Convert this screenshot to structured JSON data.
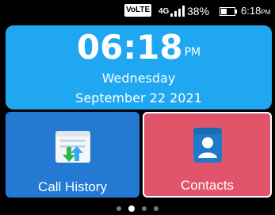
{
  "status_bar": {
    "volte": "VoLTE",
    "network": "4G",
    "battery_percent": "38%",
    "time": "6:18",
    "time_suffix": "PM",
    "signal_icon": "signal-icon",
    "battery_icon": "battery-icon"
  },
  "clock": {
    "time": "06:18",
    "ampm": "PM",
    "day": "Wednesday",
    "date": "September 22 2021"
  },
  "tiles": [
    {
      "label": "Call History",
      "icon": "call-history-icon",
      "color": "#2479d3"
    },
    {
      "label": "Contacts",
      "icon": "contacts-icon",
      "color": "#e2546a"
    }
  ],
  "pager": {
    "count": 4,
    "active_index": 1
  }
}
